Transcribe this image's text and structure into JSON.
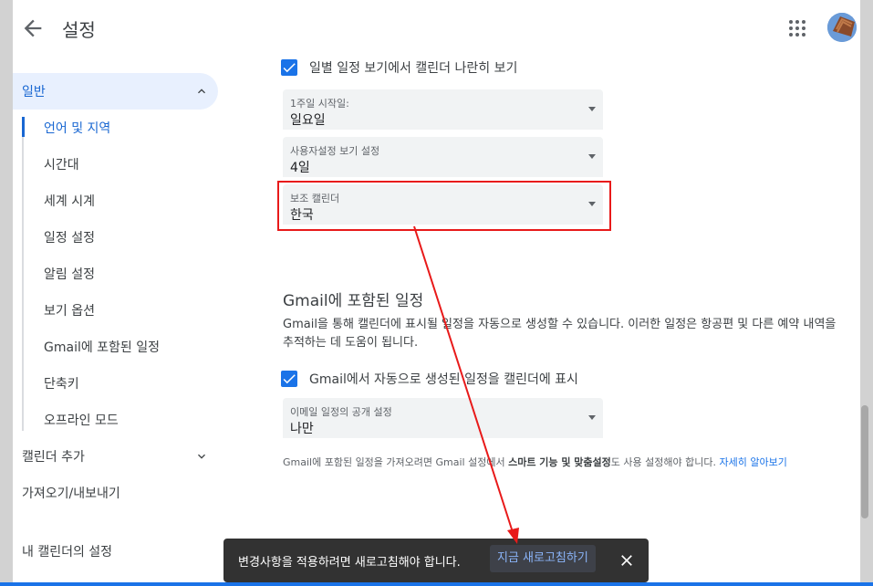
{
  "header": {
    "title": "설정"
  },
  "sidebar": {
    "general": "일반",
    "sub_items": [
      "언어 및 지역",
      "시간대",
      "세계 시계",
      "일정 설정",
      "알림 설정",
      "보기 옵션",
      "Gmail에 포함된 일정",
      "단축키",
      "오프라인 모드"
    ],
    "add_calendar": "캘린더 추가",
    "import_export": "가져오기/내보내기",
    "my_calendars": "내 캘린더의 설정",
    "partial_item": "..."
  },
  "content": {
    "side_by_side_label": "일별 일정 보기에서 캘린더 나란히 보기",
    "week_start": {
      "label": "1주일 시작일:",
      "value": "일요일"
    },
    "custom_view": {
      "label": "사용자설정 보기 설정",
      "value": "4일"
    },
    "alt_calendar": {
      "label": "보조 캘린더",
      "value": "한국"
    },
    "gmail_heading": "Gmail에 포함된 일정",
    "gmail_desc": "Gmail을 통해 캘린더에 표시될 일정을 자동으로 생성할 수 있습니다. 이러한 일정은 항공편 및 다른 예약 내역을 추적하는 데 도움이 됩니다.",
    "gmail_checkbox_label": "Gmail에서 자동으로 생성된 일정을 캘린더에 표시",
    "email_privacy": {
      "label": "이메일 일정의 공개 설정",
      "value": "나만"
    },
    "note_prefix": "Gmail에 포함된 일정을 가져오려면 Gmail 설정에서 ",
    "note_bold": "스마트 기능 및 맞춤설정",
    "note_suffix": "도 사용 설정해야 합니다. ",
    "note_link": "자세히 알아보기"
  },
  "toast": {
    "message": "변경사항을 적용하려면 새로고침해야 합니다.",
    "action": "지금 새로고침하기"
  },
  "colors": {
    "accent": "#1a73e8",
    "annotation": "#e81a1a"
  }
}
